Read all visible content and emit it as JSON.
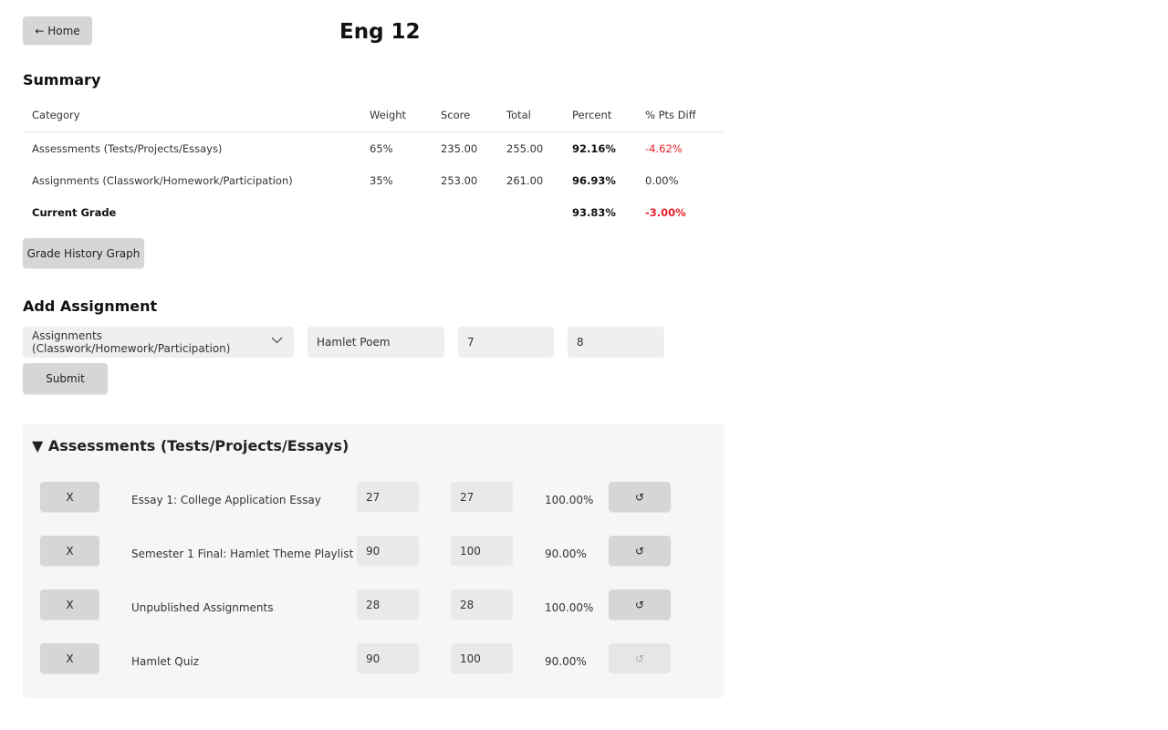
{
  "header": {
    "home_label": "← Home",
    "title": "Eng 12"
  },
  "summary": {
    "heading": "Summary",
    "columns": [
      "Category",
      "Weight",
      "Score",
      "Total",
      "Percent",
      "% Pts Diff"
    ],
    "rows": [
      {
        "category": "Assessments (Tests/Projects/Essays)",
        "weight": "65%",
        "score": "235.00",
        "total": "255.00",
        "percent": "92.16%",
        "diff": "-4.62%"
      },
      {
        "category": "Assignments (Classwork/Homework/Participation)",
        "weight": "35%",
        "score": "253.00",
        "total": "261.00",
        "percent": "96.93%",
        "diff": "0.00%"
      }
    ],
    "current": {
      "label": "Current Grade",
      "percent": "93.83%",
      "diff": "-3.00%"
    },
    "graph_button": "Grade History Graph"
  },
  "add_assignment": {
    "heading": "Add Assignment",
    "category_selected": "Assignments (Classwork/Homework/Participation)",
    "name_value": "Hamlet Poem",
    "score_value": "7",
    "total_value": "8",
    "submit_label": "Submit"
  },
  "section": {
    "title": "▼ Assessments (Tests/Projects/Essays)",
    "delete_label": "X",
    "reset_icon": "↺",
    "items": [
      {
        "name": "Essay 1: College Application Essay",
        "score": "27",
        "total": "27",
        "percent": "100.00%"
      },
      {
        "name": "Semester 1 Final: Hamlet Theme Playlist",
        "score": "90",
        "total": "100",
        "percent": "90.00%"
      },
      {
        "name": "Unpublished Assignments",
        "score": "28",
        "total": "28",
        "percent": "100.00%"
      },
      {
        "name": "Hamlet Quiz",
        "score": "90",
        "total": "100",
        "percent": "90.00%"
      }
    ]
  },
  "colors": {
    "negative": "#e8202a",
    "button": "#d6d6d6",
    "field": "#efefef",
    "panel": "#f6f6f6"
  }
}
